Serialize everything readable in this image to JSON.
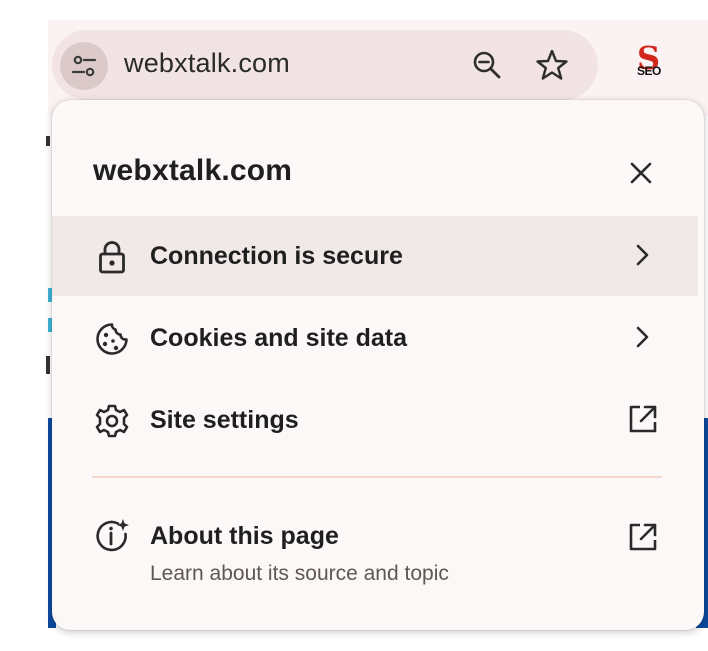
{
  "toolbar": {
    "url": "webxtalk.com",
    "site_info_icon": "tune-icon",
    "zoom_icon": "zoom-out-icon",
    "bookmark_icon": "star-icon",
    "extension": {
      "name": "seo-extension-icon",
      "letter": "S",
      "text": "SEO"
    }
  },
  "popup": {
    "title": "webxtalk.com",
    "close_icon": "close-icon",
    "items": [
      {
        "label": "Connection is secure",
        "icon": "lock-icon",
        "trailing": "chevron-right-icon",
        "highlighted": true
      },
      {
        "label": "Cookies and site data",
        "icon": "cookie-icon",
        "trailing": "chevron-right-icon",
        "highlighted": false
      },
      {
        "label": "Site settings",
        "icon": "gear-icon",
        "trailing": "open-in-new-icon",
        "highlighted": false
      }
    ],
    "about": {
      "label": "About this page",
      "sublabel": "Learn about its source and topic",
      "icon": "info-sparkle-icon",
      "trailing": "open-in-new-icon"
    }
  },
  "colors": {
    "popup_bg": "#fdf8f8",
    "highlight": "#f1e8e8",
    "omnibox": "#f2e4e4",
    "divider": "#f3d9cc",
    "extension_red": "#d0281c"
  }
}
